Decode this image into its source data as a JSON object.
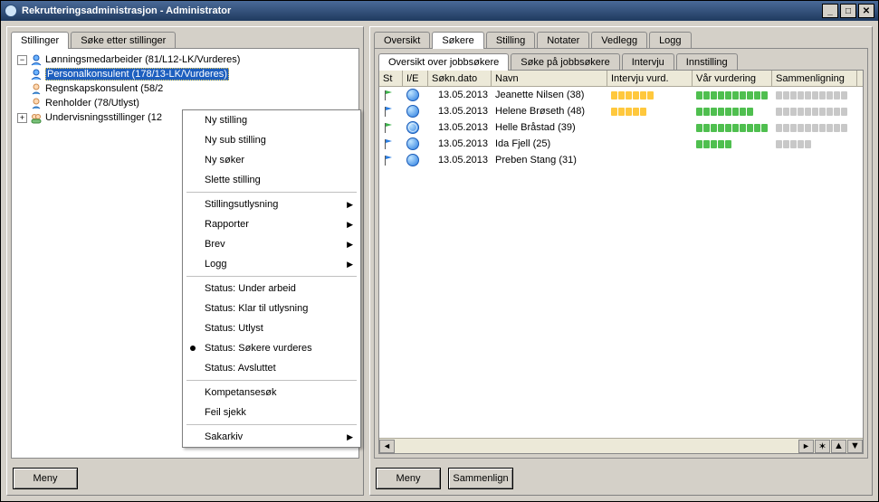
{
  "title": "Rekrutteringsadministrasjon - Administrator",
  "leftTabs": [
    "Stillinger",
    "Søke etter stillinger"
  ],
  "leftActive": 0,
  "tree": {
    "items": [
      {
        "icon": "user-blue",
        "label": "Lønningsmedarbeider (81/L12-LK/Vurderes)",
        "expander": "minus"
      },
      {
        "icon": "user-blue",
        "label": "Personalkonsulent (178/13-LK/Vurderes)",
        "selected": true
      },
      {
        "icon": "head",
        "label": "Regnskapskonsulent (58/2"
      },
      {
        "icon": "head",
        "label": "Renholder (78/Utlyst)"
      },
      {
        "icon": "group",
        "label": "Undervisningsstillinger (12",
        "expander": "plus"
      }
    ]
  },
  "context": [
    {
      "type": "item",
      "label": "Ny stilling"
    },
    {
      "type": "item",
      "label": "Ny sub stilling"
    },
    {
      "type": "item",
      "label": "Ny søker",
      "disabled": true
    },
    {
      "type": "item",
      "label": "Slette stilling",
      "disabled": true
    },
    {
      "type": "sep"
    },
    {
      "type": "item",
      "label": "Stillingsutlysning",
      "submenu": true
    },
    {
      "type": "item",
      "label": "Rapporter",
      "submenu": true
    },
    {
      "type": "item",
      "label": "Brev",
      "submenu": true
    },
    {
      "type": "item",
      "label": "Logg",
      "submenu": true
    },
    {
      "type": "sep"
    },
    {
      "type": "item",
      "label": "Status: Under arbeid"
    },
    {
      "type": "item",
      "label": "Status: Klar til utlysning"
    },
    {
      "type": "item",
      "label": "Status: Utlyst"
    },
    {
      "type": "item",
      "label": "Status: Søkere vurderes",
      "bullet": true
    },
    {
      "type": "item",
      "label": "Status: Avsluttet"
    },
    {
      "type": "sep"
    },
    {
      "type": "item",
      "label": "Kompetansesøk"
    },
    {
      "type": "item",
      "label": "Feil sjekk"
    },
    {
      "type": "sep"
    },
    {
      "type": "item",
      "label": "Sakarkiv",
      "submenu": true
    }
  ],
  "leftBtn": "Meny",
  "rightTabs": [
    "Oversikt",
    "Søkere",
    "Stilling",
    "Notater",
    "Vedlegg",
    "Logg"
  ],
  "rightActive": 1,
  "subTabs": [
    "Oversikt over jobbsøkere",
    "Søke på jobbsøkere",
    "Intervju",
    "Innstilling"
  ],
  "subActive": 0,
  "gridHeaders": {
    "st": "St",
    "ie": "I/E",
    "date": "Søkn.dato",
    "name": "Navn",
    "int": "Intervju vurd.",
    "vur": "Vår vurdering",
    "sam": "Sammenligning"
  },
  "rows": [
    {
      "flag": "green",
      "globe": "plain",
      "date": "13.05.2013",
      "name": "Jeanette Nilsen (38)",
      "int": "yyyyyy",
      "vur": "gggggggggg",
      "sam": "eeeeeeeeee"
    },
    {
      "flag": "blue",
      "globe": "plain",
      "date": "13.05.2013",
      "name": "Helene Brøseth (48)",
      "int": "yyyyy",
      "vur": "gggggggg",
      "sam": "eeeeeeeeee"
    },
    {
      "flag": "green",
      "globe": "grid",
      "date": "13.05.2013",
      "name": "Helle Bråstad (39)",
      "int": "",
      "vur": "gggggggggg",
      "sam": "eeeeeeeeee"
    },
    {
      "flag": "blue",
      "globe": "plain",
      "date": "13.05.2013",
      "name": "Ida Fjell (25)",
      "int": "",
      "vur": "ggggg",
      "sam": "eeeee"
    },
    {
      "flag": "blue",
      "globe": "plain",
      "date": "13.05.2013",
      "name": "Preben Stang (31)",
      "int": "",
      "vur": "",
      "sam": ""
    }
  ],
  "rightBtns": [
    "Meny",
    "Sammenlign"
  ]
}
